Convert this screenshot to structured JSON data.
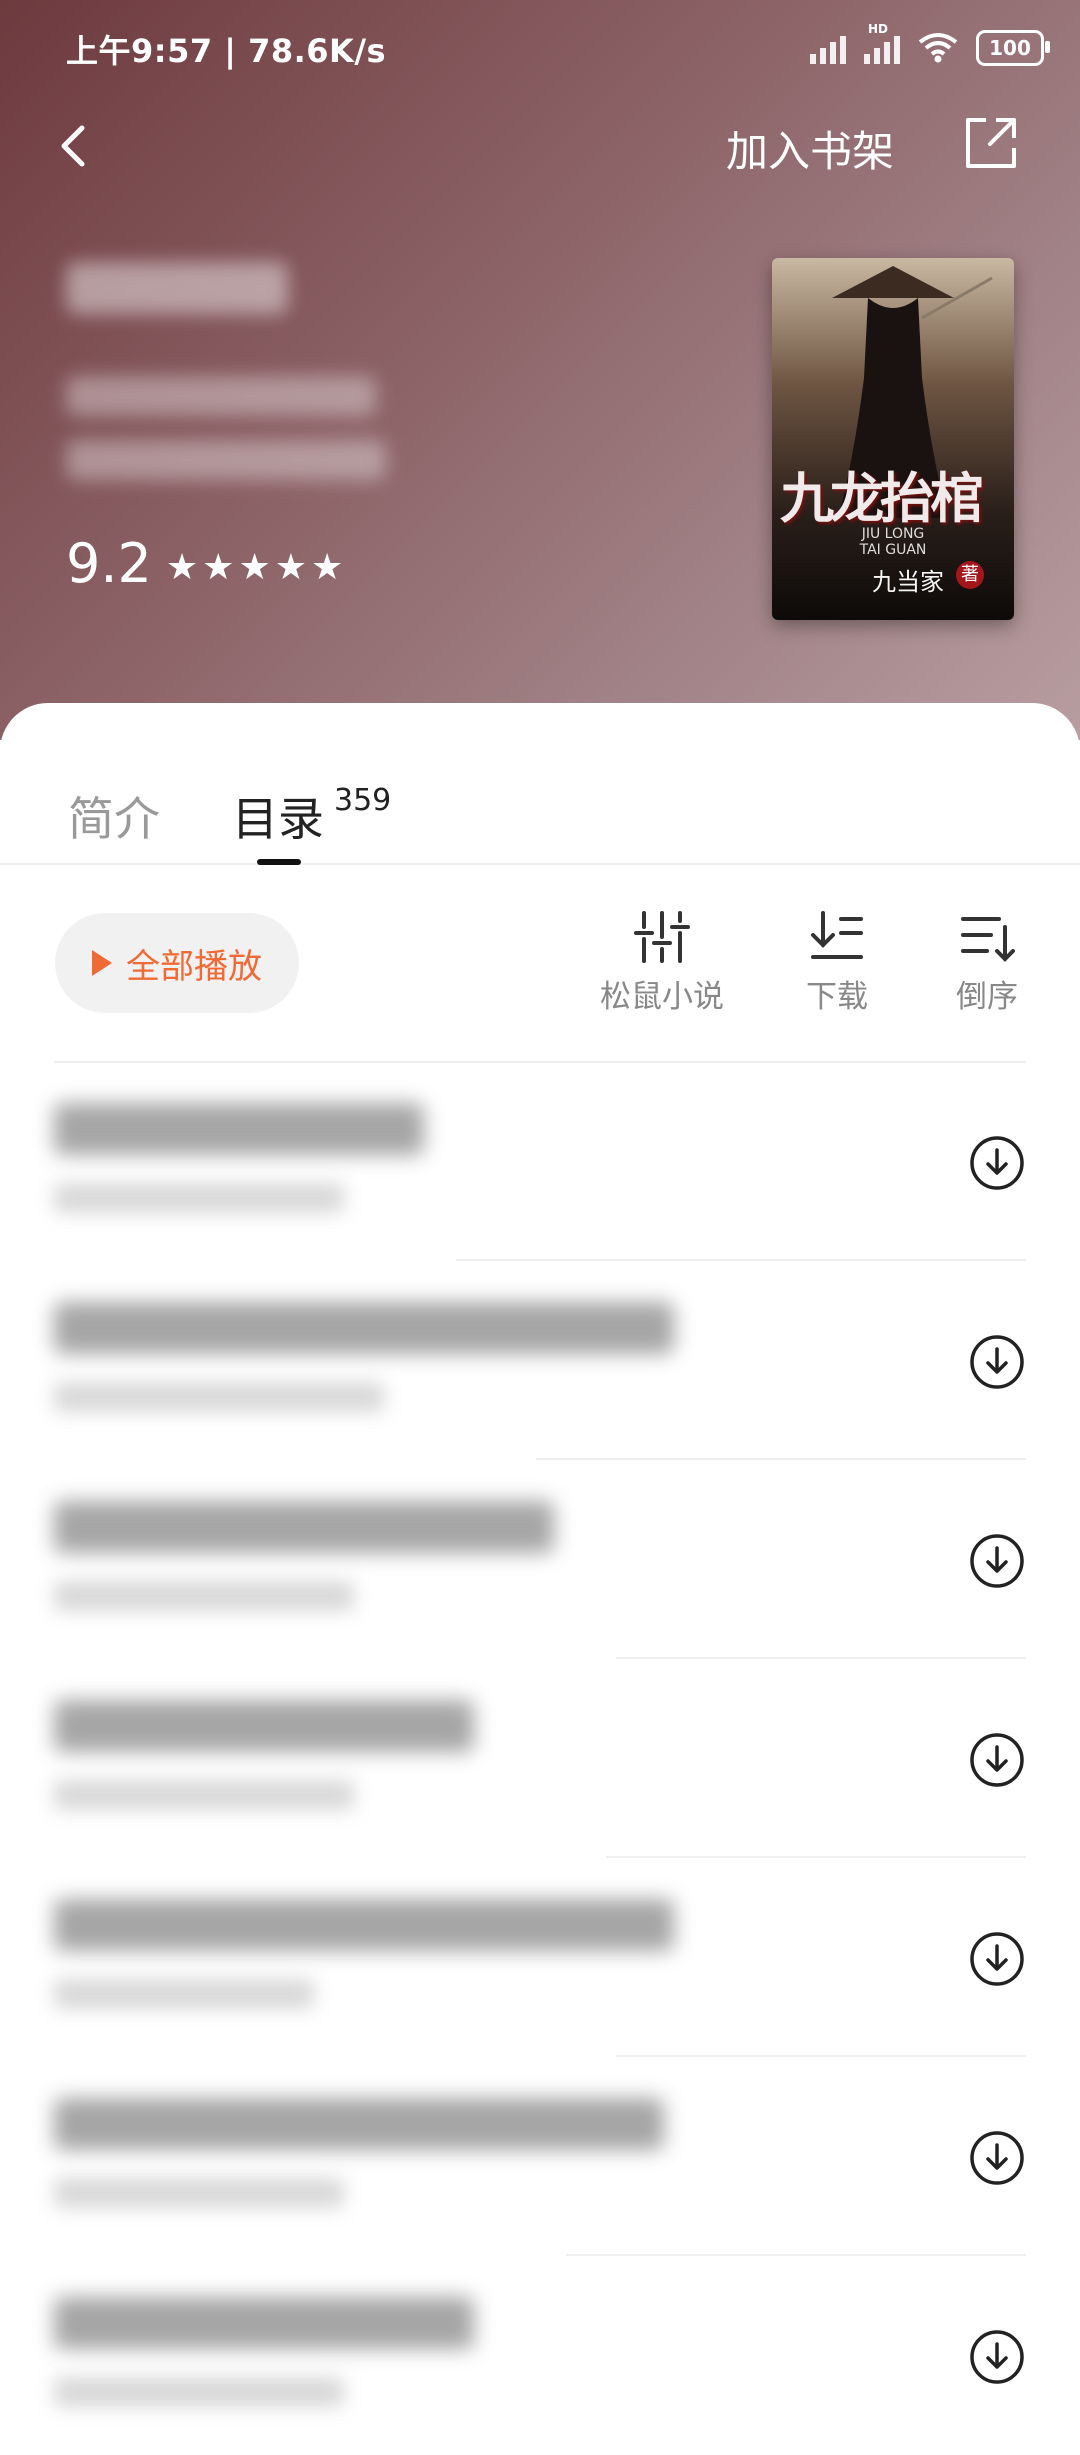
{
  "status_bar": {
    "time_speed": "上午9:57 | 78.6K/s",
    "battery": "100",
    "network_tag": "HD"
  },
  "header": {
    "add_to_shelf": "加入书架",
    "rating_score": "9.2",
    "rating_stars": "★★★★★",
    "gradient_colors": [
      "#6d3a3e",
      "#b89da0"
    ]
  },
  "cover": {
    "title": "九龙抬棺",
    "subtitle_line1": "JIU LONG",
    "subtitle_line2": "TAI GUAN",
    "author": "九当家",
    "seal": "著"
  },
  "tabs": {
    "intro": "简介",
    "toc": "目录",
    "toc_count": "359"
  },
  "toolbar": {
    "play_all": "全部播放",
    "accent_color": "#f06a35",
    "tools": [
      {
        "label": "松鼠小说",
        "icon": "sliders-icon"
      },
      {
        "label": "下载",
        "icon": "download-list-icon"
      },
      {
        "label": "倒序",
        "icon": "sort-reverse-icon"
      }
    ]
  },
  "chapters": {
    "row_count": 7,
    "download_icon": "download-circle-icon"
  }
}
